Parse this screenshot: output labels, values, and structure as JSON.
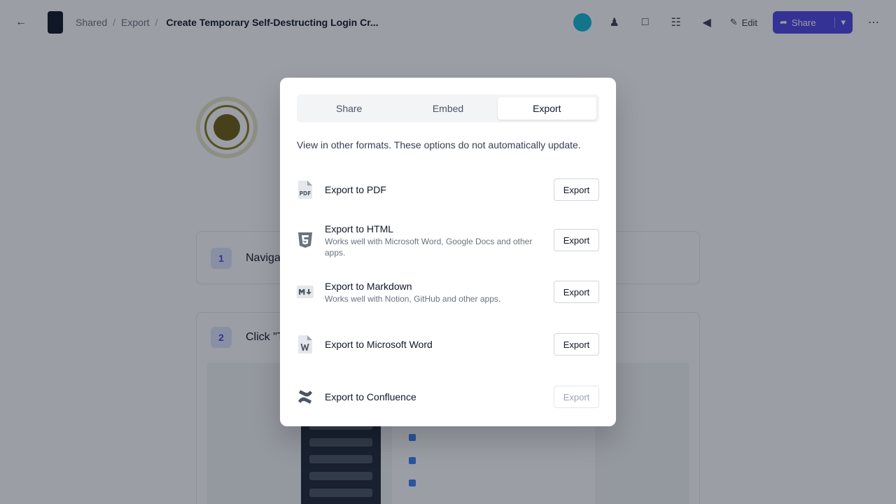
{
  "app": {
    "breadcrumb": [
      "Shared",
      "Export"
    ],
    "doc_title": "Create Temporary Self-Destructing Login Cr...",
    "edit_label": "Edit",
    "share_label": "Share",
    "accent_color": "#4f46e5"
  },
  "background": {
    "steps": [
      {
        "number": "1",
        "text": "Navigate to ..."
      },
      {
        "number": "2",
        "text": "Click \"Te..."
      }
    ]
  },
  "modal": {
    "tabs": [
      {
        "label": "Share",
        "active": false
      },
      {
        "label": "Embed",
        "active": false
      },
      {
        "label": "Export",
        "active": true
      }
    ],
    "description": "View in other formats. These options do not automatically update.",
    "exports": [
      {
        "icon": "pdf-file-icon",
        "title": "Export to PDF",
        "subtitle": "",
        "button": "Export",
        "enabled": true
      },
      {
        "icon": "html5-icon",
        "title": "Export to HTML",
        "subtitle": "Works well with Microsoft Word, Google Docs and other apps.",
        "button": "Export",
        "enabled": true
      },
      {
        "icon": "markdown-icon",
        "title": "Export to Markdown",
        "subtitle": "Works well with Notion, GitHub and other apps.",
        "button": "Export",
        "enabled": true
      },
      {
        "icon": "word-file-icon",
        "title": "Export to Microsoft Word",
        "subtitle": "",
        "button": "Export",
        "enabled": true
      },
      {
        "icon": "confluence-icon",
        "title": "Export to Confluence",
        "subtitle": "",
        "button": "Export",
        "enabled": false
      }
    ]
  }
}
